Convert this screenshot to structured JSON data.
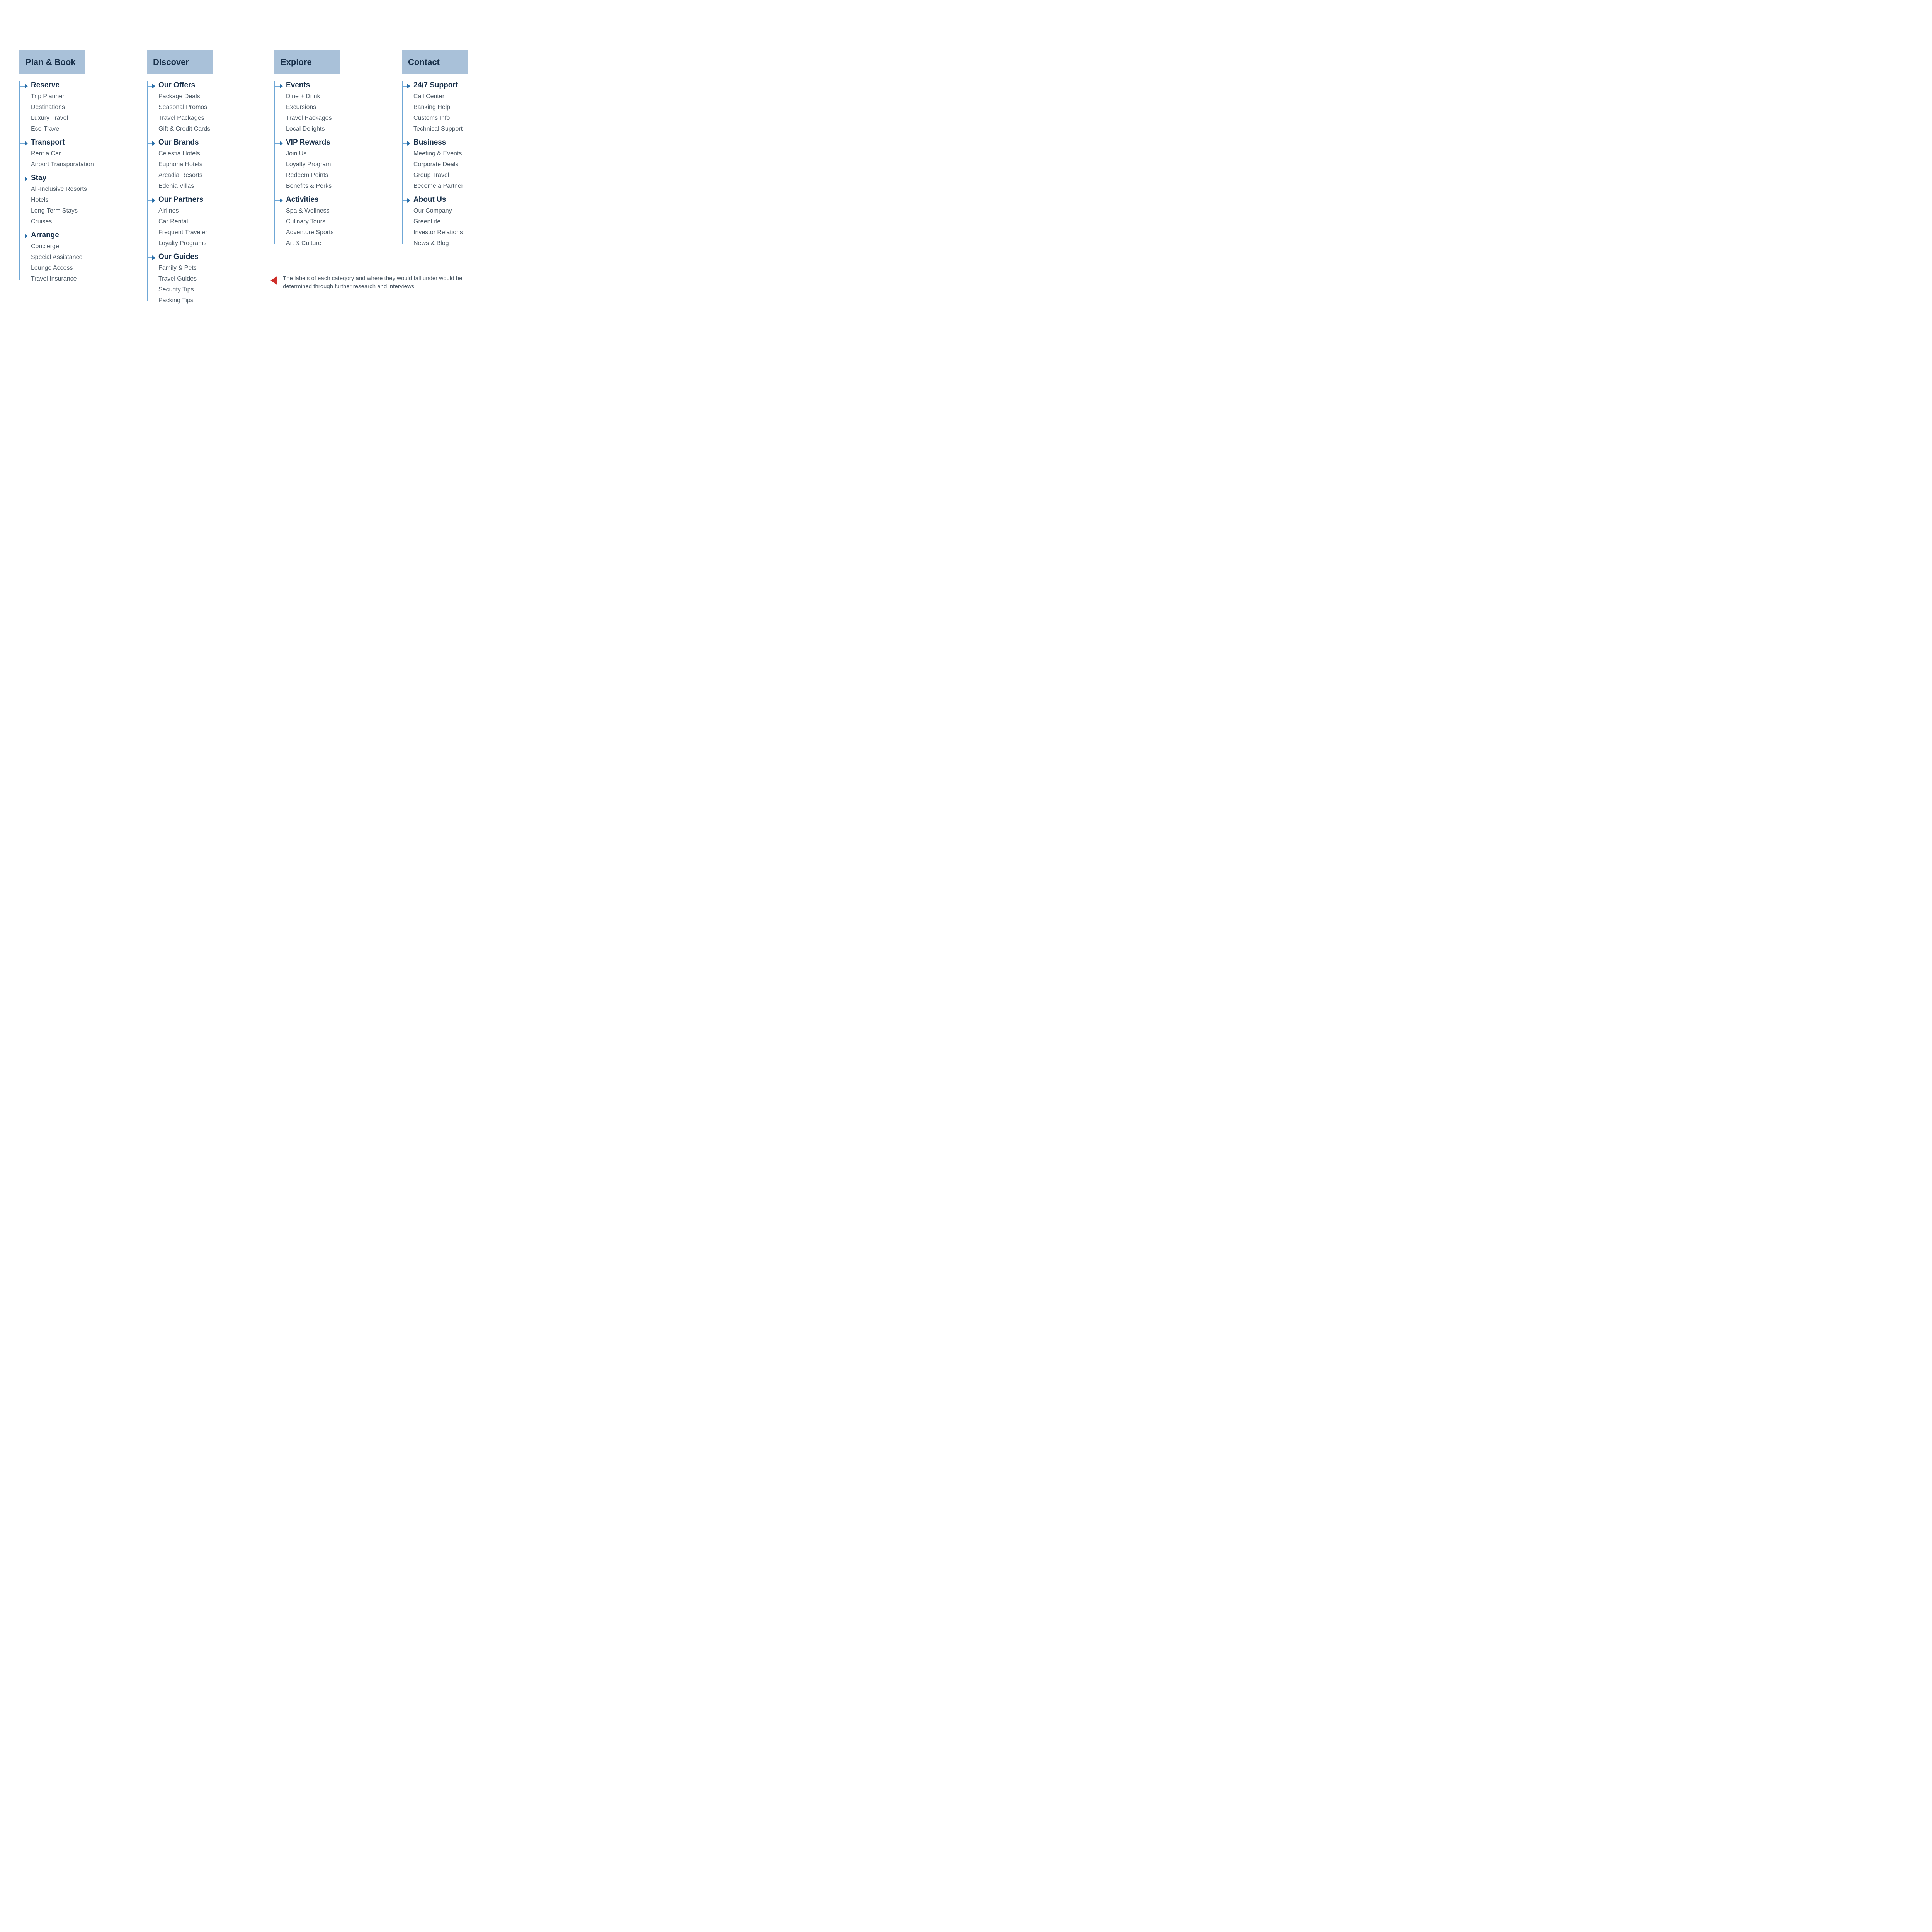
{
  "columns": [
    {
      "title": "Plan & Book",
      "groups": [
        {
          "title": "Reserve",
          "items": [
            "Trip Planner",
            "Destinations",
            "Luxury Travel",
            "Eco-Travel"
          ]
        },
        {
          "title": "Transport",
          "items": [
            "Rent a Car",
            "Airport Transporatation"
          ]
        },
        {
          "title": "Stay",
          "items": [
            "All-Inclusive Resorts",
            "Hotels",
            "Long-Term Stays",
            "Cruises"
          ]
        },
        {
          "title": "Arrange",
          "items": [
            "Concierge",
            "Special Assistance",
            "Lounge Access",
            "Travel Insurance"
          ]
        }
      ]
    },
    {
      "title": "Discover",
      "groups": [
        {
          "title": "Our Offers",
          "items": [
            "Package Deals",
            "Seasonal Promos",
            "Travel Packages",
            "Gift & Credit Cards"
          ]
        },
        {
          "title": "Our Brands",
          "items": [
            "Celestia Hotels",
            "Euphoria Hotels",
            "Arcadia Resorts",
            "Edenia Villas"
          ]
        },
        {
          "title": "Our Partners",
          "items": [
            "Airlines",
            "Car Rental",
            "Frequent Traveler",
            "Loyalty Programs"
          ]
        },
        {
          "title": "Our Guides",
          "items": [
            "Family & Pets",
            "Travel Guides",
            "Security Tips",
            "Packing Tips"
          ]
        }
      ]
    },
    {
      "title": "Explore",
      "groups": [
        {
          "title": "Events",
          "items": [
            "Dine + Drink",
            "Excursions",
            "Travel Packages",
            "Local Delights"
          ]
        },
        {
          "title": "VIP Rewards",
          "items": [
            "Join Us",
            "Loyalty Program",
            "Redeem Points",
            "Benefits & Perks"
          ]
        },
        {
          "title": "Activities",
          "items": [
            "Spa & Wellness",
            "Culinary Tours",
            "Adventure Sports",
            "Art & Culture"
          ]
        }
      ]
    },
    {
      "title": "Contact",
      "groups": [
        {
          "title": "24/7 Support",
          "items": [
            "Call Center",
            "Banking Help",
            "Customs Info",
            "Technical Support"
          ]
        },
        {
          "title": "Business",
          "items": [
            "Meeting & Events",
            "Corporate Deals",
            "Group Travel",
            "Become a Partner"
          ]
        },
        {
          "title": "About Us",
          "items": [
            "Our Company",
            "GreenLife",
            "Investor Relations",
            "News & Blog"
          ]
        }
      ]
    }
  ],
  "note": "The labels of each category and where they would fall under would be determined through further research and interviews."
}
